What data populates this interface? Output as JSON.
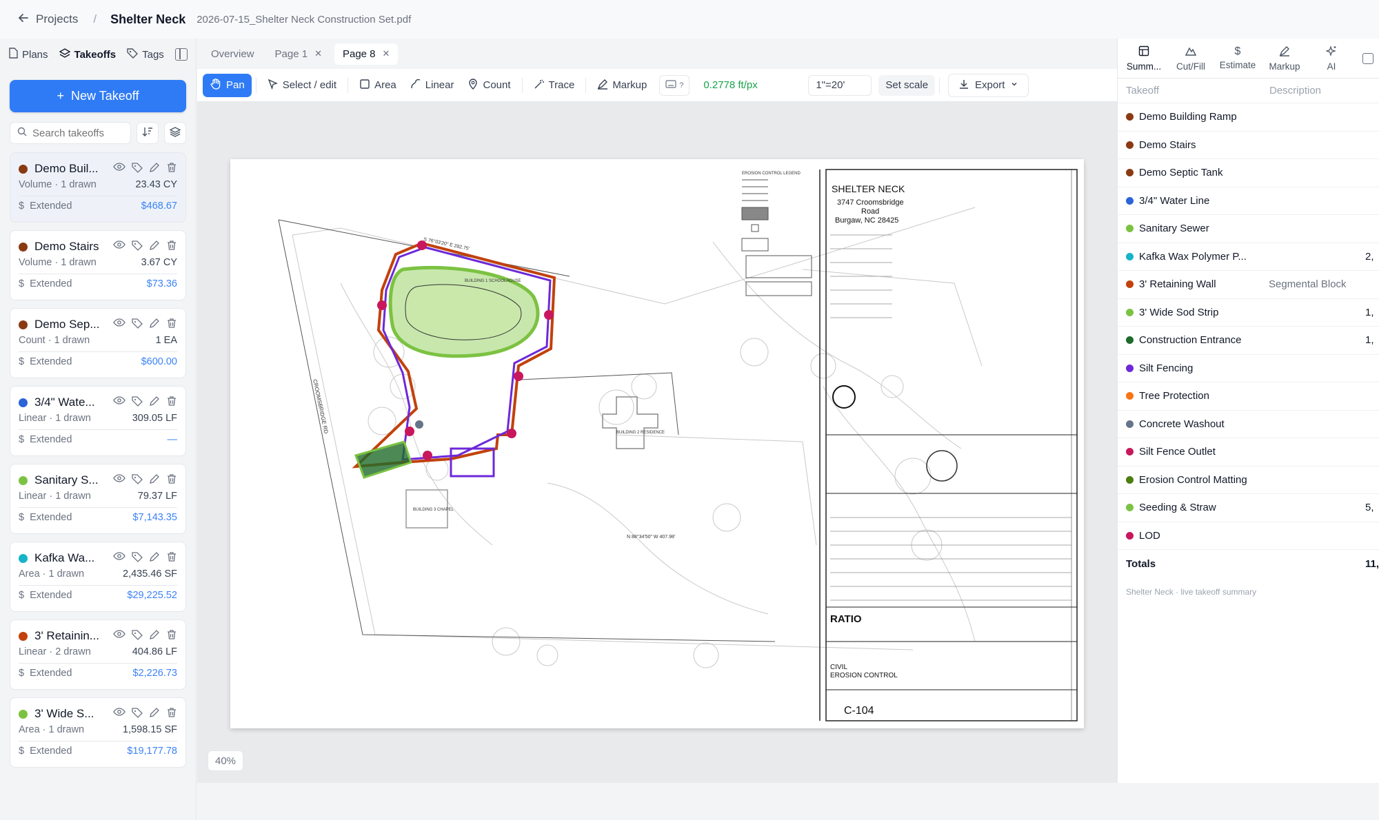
{
  "header": {
    "back_label": "Projects",
    "project": "Shelter Neck",
    "file": "2026-07-15_Shelter Neck Construction Set.pdf"
  },
  "sidebar": {
    "tabs": [
      {
        "label": "Plans",
        "icon": "document-icon"
      },
      {
        "label": "Takeoffs",
        "icon": "layers-icon"
      },
      {
        "label": "Tags",
        "icon": "tag-icon"
      }
    ],
    "new_takeoff": "New Takeoff",
    "search_placeholder": "Search takeoffs",
    "extended_label": "Extended",
    "cards": [
      {
        "name": "Demo Buil...",
        "color": "#8a3a12",
        "meta": "Volume · 1 drawn",
        "qty": "23.43 CY",
        "price": "$468.67",
        "selected": true
      },
      {
        "name": "Demo Stairs",
        "color": "#8a3a12",
        "meta": "Volume · 1 drawn",
        "qty": "3.67 CY",
        "price": "$73.36"
      },
      {
        "name": "Demo Sep...",
        "color": "#8a3a12",
        "meta": "Count · 1 drawn",
        "qty": "1 EA",
        "price": "$600.00"
      },
      {
        "name": "3/4\" Wate...",
        "color": "#2b63d9",
        "meta": "Linear · 1 drawn",
        "qty": "309.05 LF",
        "price": "—"
      },
      {
        "name": "Sanitary S...",
        "color": "#7cc242",
        "meta": "Linear · 1 drawn",
        "qty": "79.37 LF",
        "price": "$7,143.35"
      },
      {
        "name": "Kafka Wa...",
        "color": "#17b3c9",
        "meta": "Area · 1 drawn",
        "qty": "2,435.46 SF",
        "price": "$29,225.52"
      },
      {
        "name": "3' Retainin...",
        "color": "#c2410c",
        "meta": "Linear · 2 drawn",
        "qty": "404.86 LF",
        "price": "$2,226.73"
      },
      {
        "name": "3' Wide S...",
        "color": "#7cc242",
        "meta": "Area · 1 drawn",
        "qty": "1,598.15 SF",
        "price": "$19,177.78"
      }
    ]
  },
  "page_tabs": [
    {
      "label": "Overview",
      "active": false,
      "closable": false
    },
    {
      "label": "Page 1",
      "active": false,
      "closable": true
    },
    {
      "label": "Page 8",
      "active": true,
      "closable": true
    }
  ],
  "toolbar": {
    "pan": "Pan",
    "select": "Select / edit",
    "area": "Area",
    "linear": "Linear",
    "count": "Count",
    "trace": "Trace",
    "markup": "Markup",
    "shortcut_hint": "?",
    "ratio": "0.2778 ft/px",
    "scale": "1\"=20'",
    "set_scale": "Set scale",
    "export": "Export"
  },
  "sheet": {
    "title": "SHELTER NECK",
    "address1": "3747 Croomsbridge",
    "address2": "Road",
    "address3": "Burgaw, NC  28425",
    "legend_title": "EROSION CONTROL LEGEND",
    "sheet_title1": "CIVIL",
    "sheet_title2": "EROSION CONTROL",
    "sheet_number": "C-104",
    "firm": "RATIO",
    "road_label": "CROOMSBRIDGE RD",
    "building1": "BUILDING 1 SCHOOLHOUSE",
    "building2": "BUILDING 2 RESIDENCE",
    "building3": "BUILDING 3 CHAPEL",
    "bearing_top": "S 76°03'20\" E   282.75'",
    "bearing_bottom": "N 88°34'50\" W   407.98'"
  },
  "zoom": "40%",
  "summary": {
    "tabs": [
      {
        "label": "Summ...",
        "icon": "table-icon"
      },
      {
        "label": "Cut/Fill",
        "icon": "mountain-icon"
      },
      {
        "label": "Estimate",
        "icon": "dollar-icon"
      },
      {
        "label": "Markup",
        "icon": "pen-icon"
      },
      {
        "label": "AI",
        "icon": "sparkle-icon"
      }
    ],
    "col_takeoff": "Takeoff",
    "col_description": "Description",
    "rows": [
      {
        "name": "Demo Building Ramp",
        "color": "#8a3a12",
        "desc": "",
        "value": ""
      },
      {
        "name": "Demo Stairs",
        "color": "#8a3a12",
        "desc": "",
        "value": ""
      },
      {
        "name": "Demo Septic Tank",
        "color": "#8a3a12",
        "desc": "",
        "value": ""
      },
      {
        "name": "3/4\" Water Line",
        "color": "#2b63d9",
        "desc": "",
        "value": ""
      },
      {
        "name": "Sanitary Sewer",
        "color": "#7cc242",
        "desc": "",
        "value": ""
      },
      {
        "name": "Kafka Wax Polymer P...",
        "color": "#17b3c9",
        "desc": "",
        "value": "2,"
      },
      {
        "name": "3' Retaining Wall",
        "color": "#c2410c",
        "desc": "Segmental Block",
        "value": ""
      },
      {
        "name": "3' Wide Sod Strip",
        "color": "#7cc242",
        "desc": "",
        "value": "1,"
      },
      {
        "name": "Construction Entrance",
        "color": "#1f6b2b",
        "desc": "",
        "value": "1,"
      },
      {
        "name": "Silt Fencing",
        "color": "#6d28d9",
        "desc": "",
        "value": ""
      },
      {
        "name": "Tree Protection",
        "color": "#f97316",
        "desc": "",
        "value": ""
      },
      {
        "name": "Concrete Washout",
        "color": "#64748b",
        "desc": "",
        "value": ""
      },
      {
        "name": "Silt Fence Outlet",
        "color": "#c8175d",
        "desc": "",
        "value": ""
      },
      {
        "name": "Erosion Control Matting",
        "color": "#4d7c0f",
        "desc": "",
        "value": ""
      },
      {
        "name": "Seeding & Straw",
        "color": "#7cc242",
        "desc": "",
        "value": "5,"
      },
      {
        "name": "LOD",
        "color": "#c8175d",
        "desc": "",
        "value": ""
      }
    ],
    "totals_label": "Totals",
    "totals_value": "11,",
    "footer": "Shelter Neck · live takeoff summary"
  }
}
